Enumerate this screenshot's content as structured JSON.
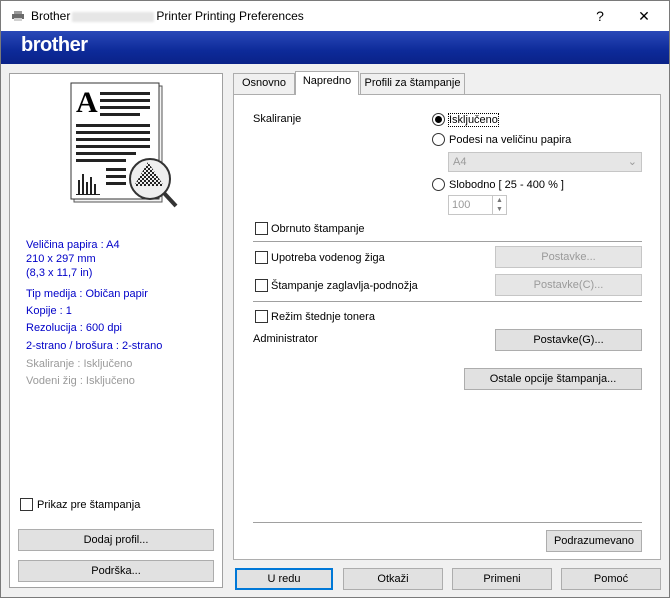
{
  "window": {
    "title_prefix": "Brother",
    "title_suffix": "Printer Printing Preferences",
    "help_label": "?",
    "close_label": "✕"
  },
  "banner": {
    "logo": "brother"
  },
  "left": {
    "info_blue": [
      "Veličina papira : A4",
      "210 x 297 mm",
      "(8,3 x 11,7 in)",
      "Tip medija : Običan papir",
      "Kopije : 1",
      "Rezolucija : 600 dpi",
      "2-strano / brošura : 2-strano"
    ],
    "info_grey": [
      "Skaliranje : Isključeno",
      "Vodeni žig : Isključeno"
    ],
    "preview_checkbox": "Prikaz pre štampanja",
    "add_profile_button": "Dodaj profil...",
    "support_button": "Podrška..."
  },
  "tabs": [
    "Osnovno",
    "Napredno",
    "Profili za štampanje"
  ],
  "panel": {
    "scaling_label": "Skaliranje",
    "scaling_off": "Isključeno",
    "scaling_fit": "Podesi na veličinu papira",
    "paper_select": "A4",
    "scaling_free": "Slobodno [ 25 - 400 % ]",
    "scaling_value": "100",
    "reverse_print": "Obrnuto štampanje",
    "watermark": "Upotreba vodenog žiga",
    "watermark_settings": "Postavke...",
    "header_footer": "Štampanje zaglavlja-podnožja",
    "header_footer_settings": "Postavke(C)...",
    "toner_save": "Režim štednje tonera",
    "administrator": "Administrator",
    "admin_settings": "Postavke(G)...",
    "other_options": "Ostale opcije štampanja...",
    "default_button": "Podrazumevano"
  },
  "footer": {
    "ok": "U redu",
    "cancel": "Otkaži",
    "apply": "Primeni",
    "help": "Pomoć"
  }
}
